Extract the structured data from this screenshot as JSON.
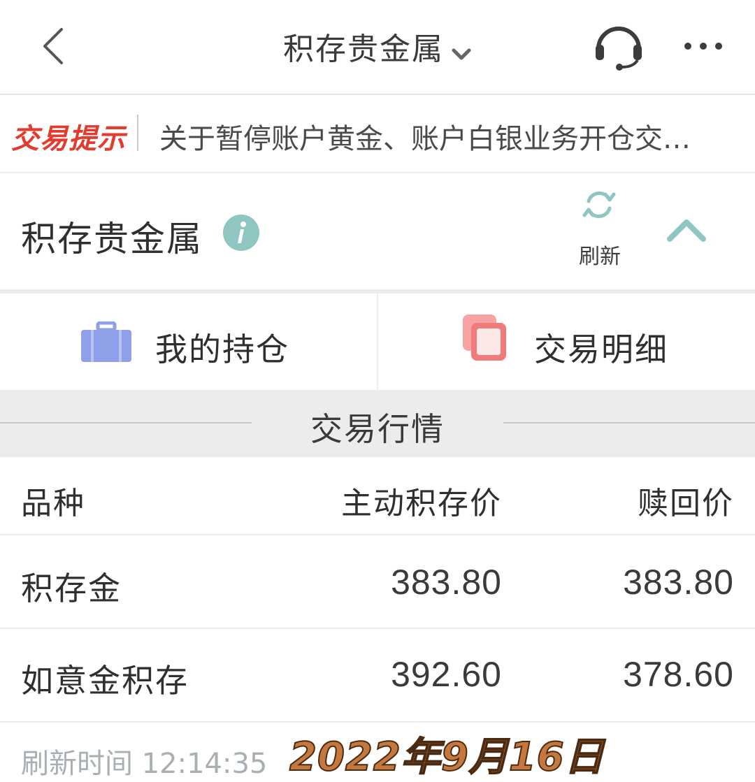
{
  "nav": {
    "title": "积存贵金属"
  },
  "notice": {
    "tag": "交易提示",
    "text": "关于暂停账户黄金、账户白银业务开仓交…"
  },
  "section": {
    "title": "积存贵金属",
    "refresh_label": "刷新"
  },
  "actions": {
    "holdings_label": "我的持仓",
    "detail_label": "交易明细"
  },
  "market": {
    "label": "交易行情"
  },
  "table": {
    "headers": [
      "品种",
      "主动积存价",
      "赎回价"
    ],
    "rows": [
      {
        "name": "积存金",
        "buy": "383.80",
        "redeem": "383.80"
      },
      {
        "name": "如意金积存",
        "buy": "392.60",
        "redeem": "378.60"
      }
    ]
  },
  "footer": {
    "refresh_time": "刷新时间 12:14:35",
    "date_stamp": "2022年9月16日"
  },
  "colors": {
    "tag_red": "#e33b2e",
    "bag_blue": "#8fa0e8",
    "detail_red": "#f07b7b",
    "teal_icon": "#8fc6c2"
  }
}
